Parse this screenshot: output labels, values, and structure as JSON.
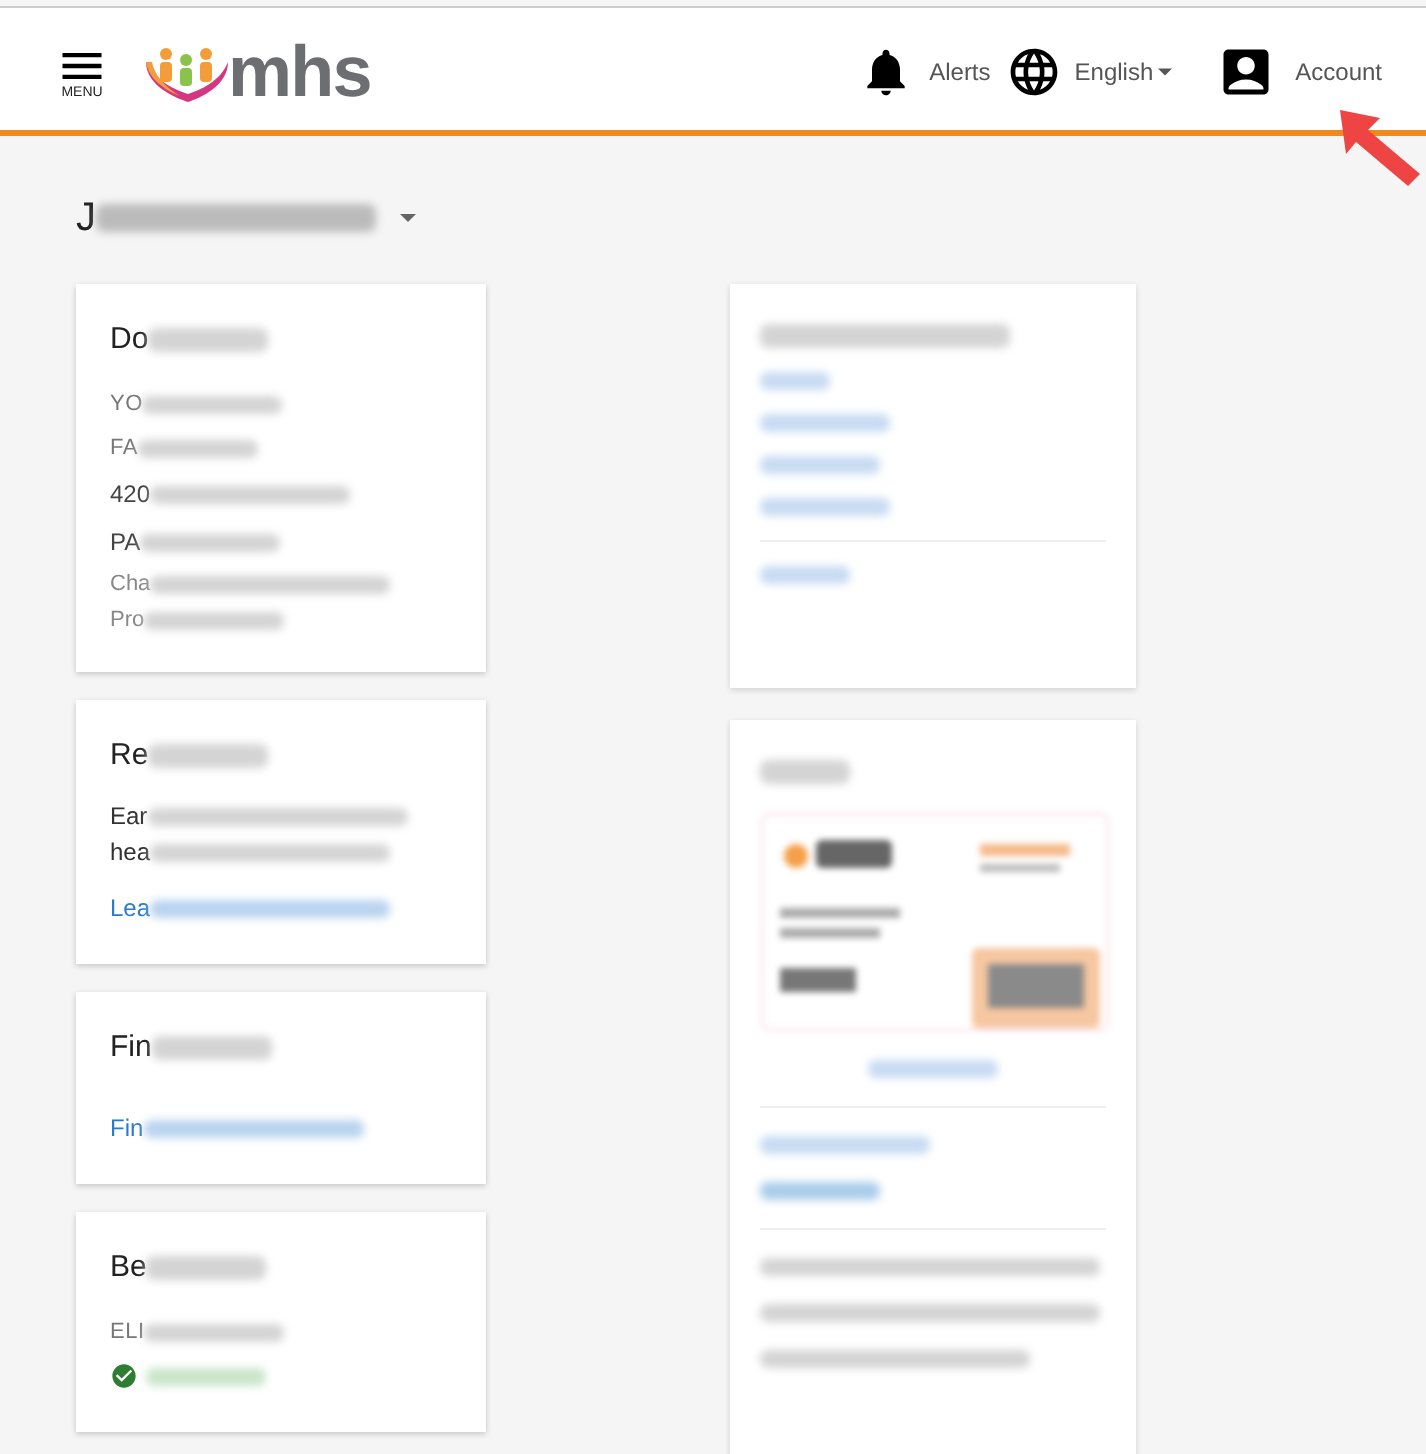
{
  "header": {
    "menu_label": "MENU",
    "logo": "mhs",
    "alerts": "Alerts",
    "language": "English",
    "account": "Account"
  },
  "member_name": "J",
  "left_cards": [
    {
      "title": "Do",
      "lines": [
        {
          "kind": "caps",
          "text": "YO"
        },
        {
          "kind": "caps",
          "text": "FA"
        },
        {
          "kind": "address",
          "text": "420"
        },
        {
          "kind": "address",
          "text": "PA"
        },
        {
          "kind": "note",
          "text": "Cha"
        },
        {
          "kind": "note",
          "text": "Pro"
        }
      ]
    },
    {
      "title": "Re",
      "lines": [
        {
          "kind": "body",
          "text": "Ear"
        },
        {
          "kind": "body",
          "text": "hea"
        },
        {
          "kind": "link",
          "text": "Lea"
        }
      ]
    },
    {
      "title": "Fin",
      "lines": [
        {
          "kind": "link",
          "text": "Fin"
        }
      ]
    },
    {
      "title": "Be",
      "lines": [
        {
          "kind": "caps",
          "text": "ELI"
        },
        {
          "kind": "status"
        }
      ]
    }
  ],
  "right_cards": [
    {
      "kind": "links"
    },
    {
      "kind": "id_card"
    }
  ]
}
